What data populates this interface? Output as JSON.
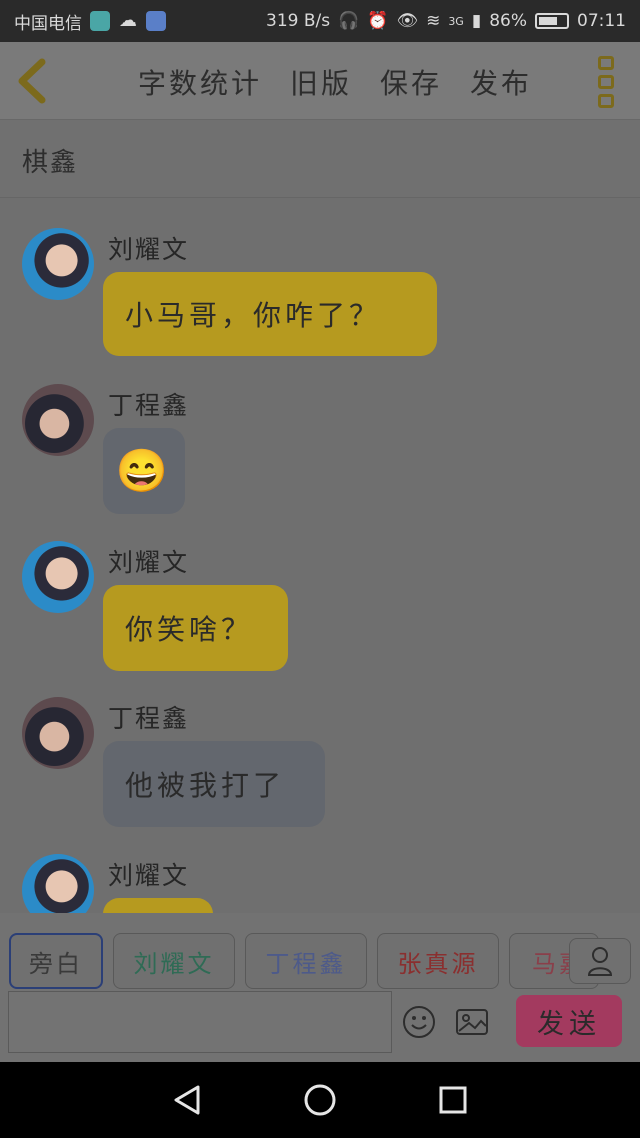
{
  "status_bar": {
    "carrier": "中国电信",
    "speed": "319 B/s",
    "network": "3G",
    "battery": "86%",
    "time": "07:11"
  },
  "topbar": {
    "actions": [
      "字数统计",
      "旧版",
      "保存",
      "发布"
    ]
  },
  "title": "棋鑫",
  "messages": [
    {
      "speaker": "刘耀文",
      "avatar": "liu",
      "text": "小马哥，你咋了？",
      "bubble": "yellow"
    },
    {
      "speaker": "丁程鑫",
      "avatar": "ding",
      "text": "😄",
      "bubble": "gray"
    },
    {
      "speaker": "刘耀文",
      "avatar": "liu",
      "text": "你笑啥？",
      "bubble": "yellow"
    },
    {
      "speaker": "丁程鑫",
      "avatar": "ding",
      "text": "他被我打了",
      "bubble": "gray"
    },
    {
      "speaker": "刘耀文",
      "avatar": "liu",
      "text": "",
      "bubble": "yellow"
    }
  ],
  "chooser": {
    "chips": [
      {
        "label": "旁白",
        "color": "#3a3a3a"
      },
      {
        "label": "刘耀文",
        "color": "#2f6b55"
      },
      {
        "label": "丁程鑫",
        "color": "#4d5a8a"
      },
      {
        "label": "张真源",
        "color": "#8a2f2f"
      },
      {
        "label": "马嘉",
        "color": "#8a3f4a"
      }
    ]
  },
  "input": {
    "placeholder": "",
    "send_label": "发送"
  },
  "colors": {
    "accent_yellow": "#b69a1f",
    "send_pink": "#a33a5f"
  }
}
